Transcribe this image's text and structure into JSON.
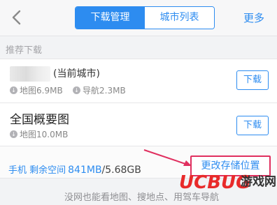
{
  "header": {
    "back_icon": "chevron-left-icon",
    "tabs": [
      {
        "label": "下载管理",
        "active": true
      },
      {
        "label": "城市列表",
        "active": false
      }
    ],
    "more_label": "更多"
  },
  "section_title": "推荐下载",
  "items": [
    {
      "name": "(当前城市)",
      "map_size": "地图6.9MB",
      "nav_size": "导航2.3MB",
      "button": "下载"
    },
    {
      "name": "全国概要图",
      "map_size": "地图10.0MB",
      "button": "下载"
    }
  ],
  "storage": {
    "label": "手机 剩余空间",
    "free": "841MB",
    "total": "/5.68GB",
    "change_button": "更改存储位置"
  },
  "footer_text": "没网也能看地图、搜地点、用驾车导航",
  "watermark": {
    "brand": "UCBUG",
    "text": "游戏网"
  },
  "colors": {
    "accent": "#2d8cf0",
    "highlight_box": "#e02f5f"
  }
}
